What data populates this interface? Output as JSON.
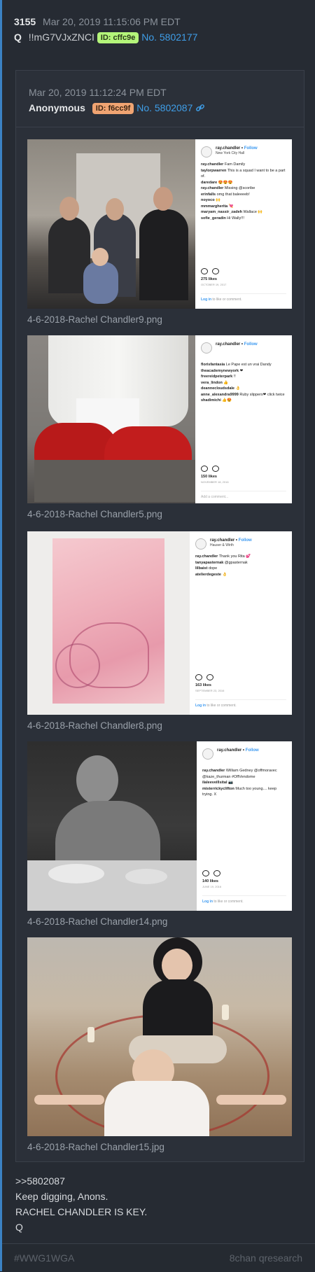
{
  "post": {
    "number": "3155",
    "timestamp": "Mar 20, 2019 11:15:06 PM EDT",
    "q": "Q",
    "tripcode": "!!mG7VJxZNCI",
    "id_badge": "ID: cffc9e",
    "post_no": "No. 5802177"
  },
  "quoted": {
    "timestamp": "Mar 20, 2019 11:12:24 PM EDT",
    "name": "Anonymous",
    "id_badge": "ID: f6cc9f",
    "post_no": "No. 5802087",
    "link_icon": "link-icon"
  },
  "images": [
    {
      "caption": "4-6-2018-Rachel Chandler9.png",
      "ig": {
        "user": "ray.chandler",
        "follow": "Follow",
        "location": "New York City Hall",
        "comments": [
          {
            "u": "ray.chandler",
            "t": "Fam Damily"
          },
          {
            "u": "taylorpwarren",
            "t": "This is a squad I want to be a part of."
          },
          {
            "u": "daredare",
            "t": "😍😍😍"
          },
          {
            "u": "ray.chandler",
            "t": "Missing @scoribe"
          },
          {
            "u": "erinfalls",
            "t": "omg that baleeeeb!"
          },
          {
            "u": "noyoco",
            "t": "🙌"
          },
          {
            "u": "mmmargherita",
            "t": "💘"
          },
          {
            "u": "maryam_nassir_zadeh",
            "t": "Wallace 🙌"
          },
          {
            "u": "sofie_geradin",
            "t": "Hi Wally!!!"
          }
        ],
        "likes": "275 likes",
        "date": "OCTOBER 19, 2017",
        "login": "Log in",
        "login_rest": "to like or comment."
      }
    },
    {
      "caption": "4-6-2018-Rachel Chandler5.png",
      "ig": {
        "user": "ray.chandler",
        "follow": "Follow",
        "location": "",
        "comments": [
          {
            "u": "florisfantasia",
            "t": "Le Pape est un vrai Dandy"
          },
          {
            "u": "theacademynewyork",
            "t": "❤"
          },
          {
            "u": "freereidpeterpark",
            "t": "!!"
          },
          {
            "u": "vera_lindon",
            "t": "👍"
          },
          {
            "u": "deannecloudsdale",
            "t": "👌"
          },
          {
            "u": "anne_alexandra9999",
            "t": "Ruby slippers❤ click twice"
          },
          {
            "u": "shadimichi",
            "t": "👍😍"
          }
        ],
        "likes": "150 likes",
        "date": "NOVEMBER 18, 2016",
        "login": "Add a comment...",
        "login_rest": ""
      }
    },
    {
      "caption": "4-6-2018-Rachel Chandler8.png",
      "ig": {
        "user": "ray.chandler",
        "follow": "Follow",
        "location": "Hauser & Wirth",
        "comments": [
          {
            "u": "ray.chandler",
            "t": "Thank you Rita 💕"
          },
          {
            "u": "tanyapasternak",
            "t": "@gpasternak"
          },
          {
            "u": "lilbaist",
            "t": "dope"
          },
          {
            "u": "atelierdegeste",
            "t": "👌"
          }
        ],
        "likes": "163 likes",
        "date": "SEPTEMBER 23, 2016",
        "login": "Log in",
        "login_rest": "to like or comment."
      }
    },
    {
      "caption": "4-6-2018-Rachel Chandler14.png",
      "ig": {
        "user": "ray.chandler",
        "follow": "Follow",
        "location": "",
        "comments": [
          {
            "u": "ray.chandler",
            "t": "William Gedney @offmoravec @kaze_thurman #OffVendome"
          },
          {
            "u": "ilaleeveillsital",
            "t": "📷"
          },
          {
            "u": "misterrickyclifton",
            "t": "Much too young.... keep trying. X"
          }
        ],
        "likes": "140 likes",
        "date": "JUNE 19, 2016",
        "login": "Log in",
        "login_rest": "to like or comment."
      }
    },
    {
      "caption": "4-6-2018-Rachel Chandler15.jpg"
    }
  ],
  "body_lines": [
    ">>5802087",
    "Keep digging, Anons.",
    "RACHEL CHANDLER IS KEY.",
    "Q"
  ],
  "footer": {
    "hashtag": "#WWG1WGA",
    "source": "8chan qresearch"
  },
  "colors": {
    "background": "#1d2128",
    "panel": "#262b33",
    "accent_link": "#3f9ee8",
    "id_green": "#b4f57a",
    "id_orange": "#f0a472"
  }
}
